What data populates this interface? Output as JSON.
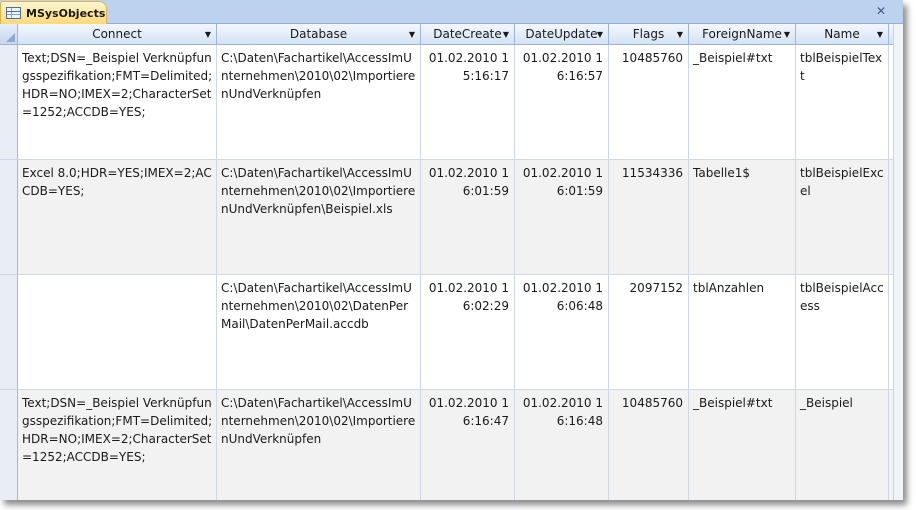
{
  "tab": {
    "title": "MSysObjects"
  },
  "columns": [
    "Connect",
    "Database",
    "DateCreate",
    "DateUpdate",
    "Flags",
    "ForeignName",
    "Name"
  ],
  "rows": [
    {
      "connect": "Text;DSN=_Beispiel Verknüpfungsspezifikation;FMT=Delimited;HDR=NO;IMEX=2;CharacterSet=1252;ACCDB=YES;",
      "database": "C:\\Daten\\Fachartikel\\AccessImUnternehmen\\2010\\02\\ImportierenUndVerknüpfen",
      "datecreate": "01.02.2010 15:16:17",
      "dateupdate": "01.02.2010 16:16:57",
      "flags": "10485760",
      "foreignname": "_Beispiel#txt",
      "name": "tblBeispielText"
    },
    {
      "connect": "Excel 8.0;HDR=YES;IMEX=2;ACCDB=YES;",
      "database": "C:\\Daten\\Fachartikel\\AccessImUnternehmen\\2010\\02\\ImportierenUndVerknüpfen\\Beispiel.xls",
      "datecreate": "01.02.2010 16:01:59",
      "dateupdate": "01.02.2010 16:01:59",
      "flags": "11534336",
      "foreignname": "Tabelle1$",
      "name": "tblBeispielExcel"
    },
    {
      "connect": "",
      "database": "C:\\Daten\\Fachartikel\\AccessImUnternehmen\\2010\\02\\DatenPerMail\\DatenPerMail.accdb",
      "datecreate": "01.02.2010 16:02:29",
      "dateupdate": "01.02.2010 16:06:48",
      "flags": "2097152",
      "foreignname": "tblAnzahlen",
      "name": "tblBeispielAccess"
    },
    {
      "connect": "Text;DSN=_Beispiel Verknüpfungsspezifikation;FMT=Delimited;HDR=NO;IMEX=2;CharacterSet=1252;ACCDB=YES;",
      "database": "C:\\Daten\\Fachartikel\\AccessImUnternehmen\\2010\\02\\ImportierenUndVerknüpfen",
      "datecreate": "01.02.2010 16:16:47",
      "dateupdate": "01.02.2010 16:16:48",
      "flags": "10485760",
      "foreignname": "_Beispiel#txt",
      "name": "_Beispiel"
    }
  ],
  "icons": {
    "tab": "table-icon",
    "sort": "dropdown-arrow-icon",
    "close": "close-icon"
  },
  "colors": {
    "tab_active": "#ffd978",
    "header": "#d4e2f5",
    "alt_row": "#f2f2f2",
    "grid_line": "#d0d7e5"
  }
}
